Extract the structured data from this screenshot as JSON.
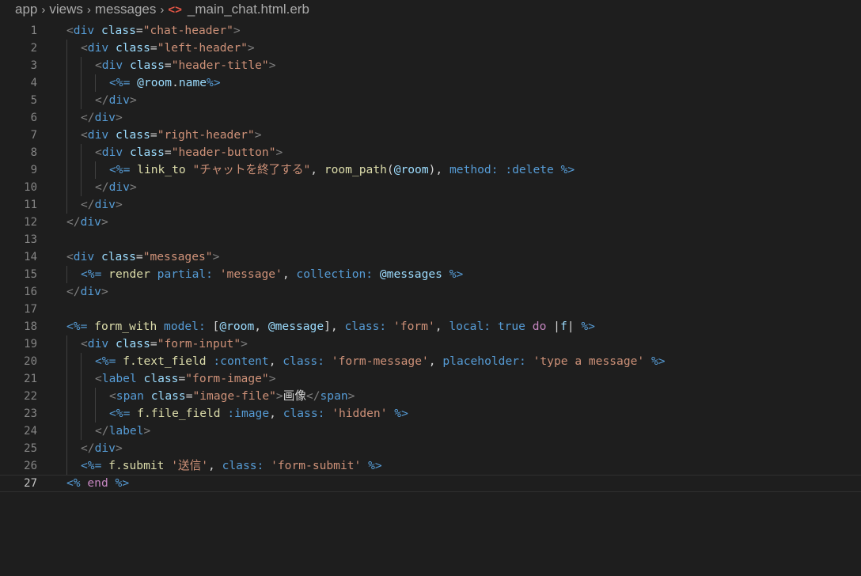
{
  "breadcrumb": {
    "parts": [
      "app",
      "views",
      "messages"
    ],
    "file_icon": "<>",
    "file_name": "_main_chat.html.erb"
  },
  "editor": {
    "current_line": 27,
    "lines": [
      {
        "n": "1",
        "indent": 0,
        "tokens": [
          [
            "br",
            "<"
          ],
          [
            "tag",
            "div"
          ],
          [
            "txt",
            " "
          ],
          [
            "attr",
            "class"
          ],
          [
            "txt",
            "="
          ],
          [
            "str",
            "\"chat-header\""
          ],
          [
            "br",
            ">"
          ]
        ]
      },
      {
        "n": "2",
        "indent": 1,
        "tokens": [
          [
            "br",
            "<"
          ],
          [
            "tag",
            "div"
          ],
          [
            "txt",
            " "
          ],
          [
            "attr",
            "class"
          ],
          [
            "txt",
            "="
          ],
          [
            "str",
            "\"left-header\""
          ],
          [
            "br",
            ">"
          ]
        ]
      },
      {
        "n": "3",
        "indent": 2,
        "tokens": [
          [
            "br",
            "<"
          ],
          [
            "tag",
            "div"
          ],
          [
            "txt",
            " "
          ],
          [
            "attr",
            "class"
          ],
          [
            "txt",
            "="
          ],
          [
            "str",
            "\"header-title\""
          ],
          [
            "br",
            ">"
          ]
        ]
      },
      {
        "n": "4",
        "indent": 3,
        "tokens": [
          [
            "erb",
            "<%="
          ],
          [
            "txt",
            " "
          ],
          [
            "ivar",
            "@room"
          ],
          [
            "txt",
            "."
          ],
          [
            "ivar",
            "name"
          ],
          [
            "erb",
            "%>"
          ]
        ]
      },
      {
        "n": "5",
        "indent": 2,
        "tokens": [
          [
            "br",
            "</"
          ],
          [
            "tag",
            "div"
          ],
          [
            "br",
            ">"
          ]
        ]
      },
      {
        "n": "6",
        "indent": 1,
        "tokens": [
          [
            "br",
            "</"
          ],
          [
            "tag",
            "div"
          ],
          [
            "br",
            ">"
          ]
        ]
      },
      {
        "n": "7",
        "indent": 1,
        "tokens": [
          [
            "br",
            "<"
          ],
          [
            "tag",
            "div"
          ],
          [
            "txt",
            " "
          ],
          [
            "attr",
            "class"
          ],
          [
            "txt",
            "="
          ],
          [
            "str",
            "\"right-header\""
          ],
          [
            "br",
            ">"
          ]
        ]
      },
      {
        "n": "8",
        "indent": 2,
        "tokens": [
          [
            "br",
            "<"
          ],
          [
            "tag",
            "div"
          ],
          [
            "txt",
            " "
          ],
          [
            "attr",
            "class"
          ],
          [
            "txt",
            "="
          ],
          [
            "str",
            "\"header-button\""
          ],
          [
            "br",
            ">"
          ]
        ]
      },
      {
        "n": "9",
        "indent": 3,
        "tokens": [
          [
            "erb",
            "<%="
          ],
          [
            "txt",
            " "
          ],
          [
            "fn",
            "link_to"
          ],
          [
            "txt",
            " "
          ],
          [
            "str",
            "\"チャットを終了する\""
          ],
          [
            "txt",
            ", "
          ],
          [
            "fn",
            "room_path"
          ],
          [
            "txt",
            "("
          ],
          [
            "ivar",
            "@room"
          ],
          [
            "txt",
            "), "
          ],
          [
            "sym",
            "method:"
          ],
          [
            "txt",
            " "
          ],
          [
            "sym",
            ":delete"
          ],
          [
            "txt",
            " "
          ],
          [
            "erb",
            "%>"
          ]
        ]
      },
      {
        "n": "10",
        "indent": 2,
        "tokens": [
          [
            "br",
            "</"
          ],
          [
            "tag",
            "div"
          ],
          [
            "br",
            ">"
          ]
        ]
      },
      {
        "n": "11",
        "indent": 1,
        "tokens": [
          [
            "br",
            "</"
          ],
          [
            "tag",
            "div"
          ],
          [
            "br",
            ">"
          ]
        ]
      },
      {
        "n": "12",
        "indent": 0,
        "tokens": [
          [
            "br",
            "</"
          ],
          [
            "tag",
            "div"
          ],
          [
            "br",
            ">"
          ]
        ]
      },
      {
        "n": "13",
        "indent": 0,
        "tokens": []
      },
      {
        "n": "14",
        "indent": 0,
        "tokens": [
          [
            "br",
            "<"
          ],
          [
            "tag",
            "div"
          ],
          [
            "txt",
            " "
          ],
          [
            "attr",
            "class"
          ],
          [
            "txt",
            "="
          ],
          [
            "str",
            "\"messages\""
          ],
          [
            "br",
            ">"
          ]
        ]
      },
      {
        "n": "15",
        "indent": 1,
        "tokens": [
          [
            "erb",
            "<%="
          ],
          [
            "txt",
            " "
          ],
          [
            "fn",
            "render"
          ],
          [
            "txt",
            " "
          ],
          [
            "sym",
            "partial:"
          ],
          [
            "txt",
            " "
          ],
          [
            "str",
            "'message'"
          ],
          [
            "txt",
            ", "
          ],
          [
            "sym",
            "collection:"
          ],
          [
            "txt",
            " "
          ],
          [
            "ivar",
            "@messages"
          ],
          [
            "txt",
            " "
          ],
          [
            "erb",
            "%>"
          ]
        ]
      },
      {
        "n": "16",
        "indent": 0,
        "tokens": [
          [
            "br",
            "</"
          ],
          [
            "tag",
            "div"
          ],
          [
            "br",
            ">"
          ]
        ]
      },
      {
        "n": "17",
        "indent": 0,
        "tokens": []
      },
      {
        "n": "18",
        "indent": 0,
        "tokens": [
          [
            "erb",
            "<%="
          ],
          [
            "txt",
            " "
          ],
          [
            "fn",
            "form_with"
          ],
          [
            "txt",
            " "
          ],
          [
            "sym",
            "model:"
          ],
          [
            "txt",
            " ["
          ],
          [
            "ivar",
            "@room"
          ],
          [
            "txt",
            ", "
          ],
          [
            "ivar",
            "@message"
          ],
          [
            "txt",
            "], "
          ],
          [
            "sym",
            "class:"
          ],
          [
            "txt",
            " "
          ],
          [
            "str",
            "'form'"
          ],
          [
            "txt",
            ", "
          ],
          [
            "sym",
            "local:"
          ],
          [
            "txt",
            " "
          ],
          [
            "sym",
            "true"
          ],
          [
            "txt",
            " "
          ],
          [
            "kw",
            "do"
          ],
          [
            "txt",
            " |"
          ],
          [
            "ivar",
            "f"
          ],
          [
            "txt",
            "| "
          ],
          [
            "erb",
            "%>"
          ]
        ]
      },
      {
        "n": "19",
        "indent": 1,
        "tokens": [
          [
            "br",
            "<"
          ],
          [
            "tag",
            "div"
          ],
          [
            "txt",
            " "
          ],
          [
            "attr",
            "class"
          ],
          [
            "txt",
            "="
          ],
          [
            "str",
            "\"form-input\""
          ],
          [
            "br",
            ">"
          ]
        ]
      },
      {
        "n": "20",
        "indent": 2,
        "tokens": [
          [
            "erb",
            "<%="
          ],
          [
            "txt",
            " "
          ],
          [
            "fn",
            "f.text_field"
          ],
          [
            "txt",
            " "
          ],
          [
            "sym",
            ":content"
          ],
          [
            "txt",
            ", "
          ],
          [
            "sym",
            "class:"
          ],
          [
            "txt",
            " "
          ],
          [
            "str",
            "'form-message'"
          ],
          [
            "txt",
            ", "
          ],
          [
            "sym",
            "placeholder:"
          ],
          [
            "txt",
            " "
          ],
          [
            "str",
            "'type a message'"
          ],
          [
            "txt",
            " "
          ],
          [
            "erb",
            "%>"
          ]
        ]
      },
      {
        "n": "21",
        "indent": 2,
        "tokens": [
          [
            "br",
            "<"
          ],
          [
            "tag",
            "label"
          ],
          [
            "txt",
            " "
          ],
          [
            "attr",
            "class"
          ],
          [
            "txt",
            "="
          ],
          [
            "str",
            "\"form-image\""
          ],
          [
            "br",
            ">"
          ]
        ]
      },
      {
        "n": "22",
        "indent": 3,
        "tokens": [
          [
            "br",
            "<"
          ],
          [
            "tag",
            "span"
          ],
          [
            "txt",
            " "
          ],
          [
            "attr",
            "class"
          ],
          [
            "txt",
            "="
          ],
          [
            "str",
            "\"image-file\""
          ],
          [
            "br",
            ">"
          ],
          [
            "txt",
            "画像"
          ],
          [
            "br",
            "</"
          ],
          [
            "tag",
            "span"
          ],
          [
            "br",
            ">"
          ]
        ]
      },
      {
        "n": "23",
        "indent": 3,
        "tokens": [
          [
            "erb",
            "<%="
          ],
          [
            "txt",
            " "
          ],
          [
            "fn",
            "f.file_field"
          ],
          [
            "txt",
            " "
          ],
          [
            "sym",
            ":image"
          ],
          [
            "txt",
            ", "
          ],
          [
            "sym",
            "class:"
          ],
          [
            "txt",
            " "
          ],
          [
            "str",
            "'hidden'"
          ],
          [
            "txt",
            " "
          ],
          [
            "erb",
            "%>"
          ]
        ]
      },
      {
        "n": "24",
        "indent": 2,
        "tokens": [
          [
            "br",
            "</"
          ],
          [
            "tag",
            "label"
          ],
          [
            "br",
            ">"
          ]
        ]
      },
      {
        "n": "25",
        "indent": 1,
        "tokens": [
          [
            "br",
            "</"
          ],
          [
            "tag",
            "div"
          ],
          [
            "br",
            ">"
          ]
        ]
      },
      {
        "n": "26",
        "indent": 1,
        "tokens": [
          [
            "erb",
            "<%="
          ],
          [
            "txt",
            " "
          ],
          [
            "fn",
            "f.submit"
          ],
          [
            "txt",
            " "
          ],
          [
            "str",
            "'送信'"
          ],
          [
            "txt",
            ", "
          ],
          [
            "sym",
            "class:"
          ],
          [
            "txt",
            " "
          ],
          [
            "str",
            "'form-submit'"
          ],
          [
            "txt",
            " "
          ],
          [
            "erb",
            "%>"
          ]
        ]
      },
      {
        "n": "27",
        "indent": 0,
        "tokens": [
          [
            "erb",
            "<%"
          ],
          [
            "txt",
            " "
          ],
          [
            "kw",
            "end"
          ],
          [
            "txt",
            " "
          ],
          [
            "erb",
            "%>"
          ]
        ]
      }
    ]
  }
}
